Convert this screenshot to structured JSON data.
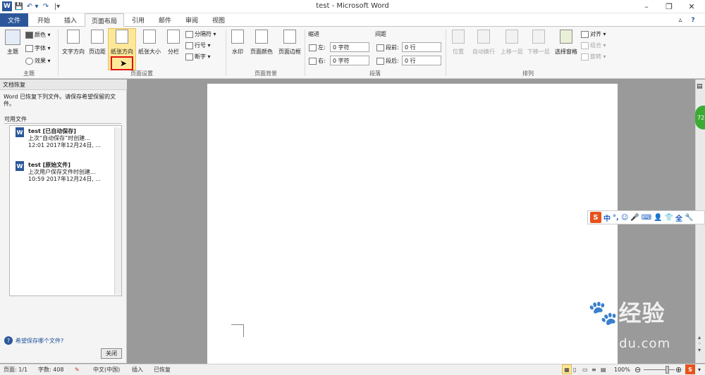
{
  "window": {
    "title": "test - Microsoft Word",
    "min_glyph": "–",
    "restore_glyph": "❐",
    "close_glyph": "✕"
  },
  "quick_access": {
    "logo": "W",
    "save": "💾",
    "undo": "↶",
    "undo_drop": "▾",
    "redo": "↷",
    "custom": "|▾"
  },
  "tabs": [
    "文件",
    "开始",
    "插入",
    "页面布局",
    "引用",
    "邮件",
    "审阅",
    "视图"
  ],
  "tabbar_icons": {
    "up": "▵",
    "help": "?"
  },
  "ribbon": {
    "theme_group": {
      "label": "主题",
      "theme": "主题",
      "colors": "颜色 ▾",
      "fonts": "字体 ▾",
      "effects": "效果 ▾"
    },
    "page_setup_group": {
      "label": "页面设置",
      "text_dir": "文字方向",
      "margins": "页边距",
      "orientation": "纸张方向",
      "size": "纸张大小",
      "columns": "分栏",
      "breaks": "分隔符 ▾",
      "line_numbers": "行号 ▾",
      "hyphenation": "断字 ▾"
    },
    "page_bg_group": {
      "label": "页面背景",
      "watermark": "水印",
      "page_color": "页面颜色",
      "page_borders": "页面边框"
    },
    "paragraph_group": {
      "label": "段落",
      "indent": "缩进",
      "spacing": "间距",
      "left_label": "左:",
      "left_value": "0 字符",
      "right_label": "右:",
      "right_value": "0 字符",
      "before_label": "段前:",
      "before_value": "0 行",
      "after_label": "段后:",
      "after_value": "0 行"
    },
    "arrange_group": {
      "label": "排列",
      "position": "位置",
      "wrap": "自动换行",
      "forward": "上移一层",
      "backward": "下移一层",
      "selection_pane": "选择窗格",
      "align": "对齐 ▾",
      "group": "组合 ▾",
      "rotate": "旋转 ▾"
    }
  },
  "recovery_pane": {
    "title": "文档恢复",
    "message": "Word 已恢复下列文件。请保存希望保留的文件。",
    "available_label": "可用文件",
    "files": [
      {
        "name": "test  [已自动保存]",
        "line2": "上次“自动保存”时创建...",
        "line3": "12:01 2017年12月24日, ..."
      },
      {
        "name": "test  [原始文件]",
        "line2": "上次用户保存文件时创建...",
        "line3": "10:59 2017年12月24日, ..."
      }
    ],
    "help_link": "希望保存哪个文件?",
    "close_button": "关闭"
  },
  "status_bar": {
    "page": "页面: 1/1",
    "words": "字数: 408",
    "language": "中文(中国)",
    "mode": "插入",
    "recovered": "已恢复",
    "zoom": "100%"
  },
  "ime": {
    "logo": "S",
    "items": [
      "中",
      "°,",
      "☺",
      "🎤",
      "⌨",
      "👤",
      "👕",
      "全",
      "🔧"
    ]
  },
  "badge": "72",
  "watermark": {
    "brand": "Bai",
    "brand_cn": "经验",
    "url": "jingyan.baidu.com"
  },
  "colors": {
    "word_blue": "#2b579a",
    "highlight_red": "#e01010"
  }
}
